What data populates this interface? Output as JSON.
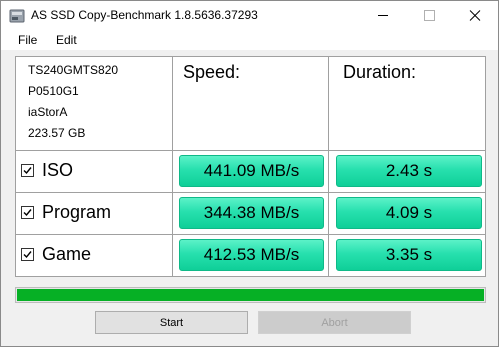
{
  "window": {
    "title": "AS SSD Copy-Benchmark 1.8.5636.37293"
  },
  "menu": {
    "file": "File",
    "edit": "Edit"
  },
  "drive": {
    "model": "TS240GMTS820",
    "firmware": "P0510G1",
    "driver": "iaStorA",
    "capacity": "223.57 GB"
  },
  "columns": {
    "speed": "Speed:",
    "duration": "Duration:"
  },
  "rows": [
    {
      "label": "ISO",
      "checked": true,
      "speed": "441.09 MB/s",
      "duration": "2.43 s"
    },
    {
      "label": "Program",
      "checked": true,
      "speed": "344.38 MB/s",
      "duration": "4.09 s"
    },
    {
      "label": "Game",
      "checked": true,
      "speed": "412.53 MB/s",
      "duration": "3.35 s"
    }
  ],
  "progress": {
    "fraction": 1.0
  },
  "buttons": {
    "start": "Start",
    "abort": "Abort"
  },
  "colors": {
    "result_cell": "#27e0ae",
    "progress_fill": "#06b025"
  }
}
